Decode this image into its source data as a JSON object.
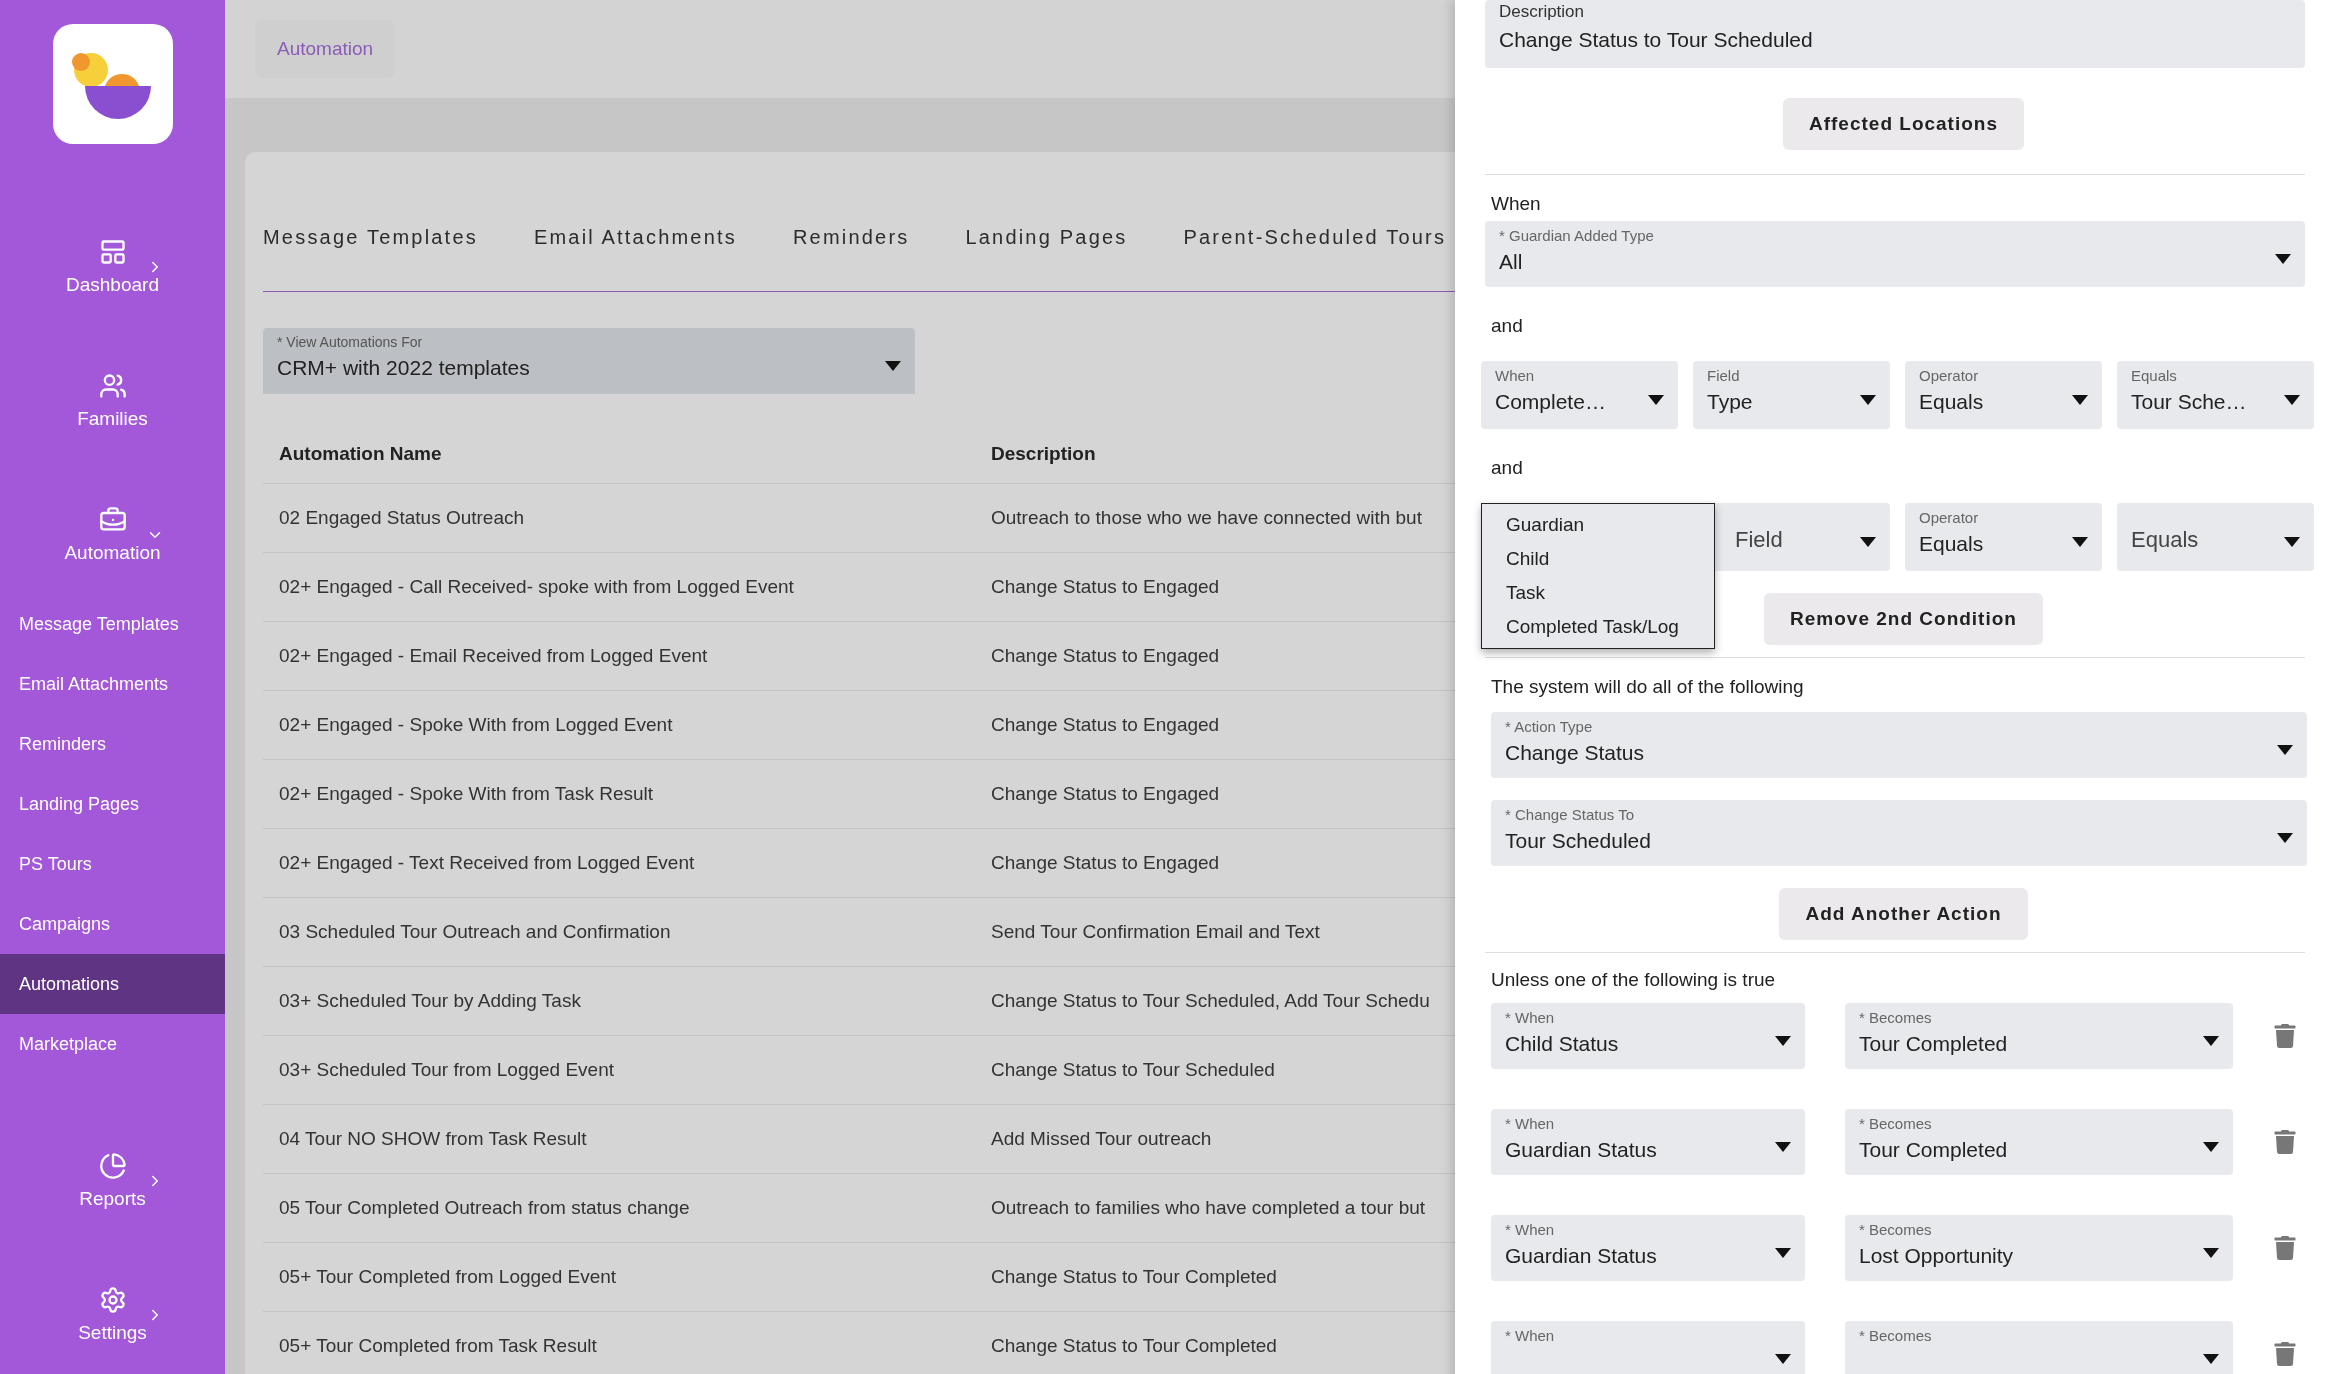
{
  "sidebar": {
    "nav": [
      {
        "label": "Dashboard",
        "kind": "dashboard",
        "expanded": false
      },
      {
        "label": "Families",
        "kind": "families"
      },
      {
        "label": "Automation",
        "kind": "automation",
        "expanded": true,
        "children": [
          {
            "label": "Message Templates",
            "selected": false
          },
          {
            "label": "Email Attachments",
            "selected": false
          },
          {
            "label": "Reminders",
            "selected": false
          },
          {
            "label": "Landing Pages",
            "selected": false
          },
          {
            "label": "PS Tours",
            "selected": false
          },
          {
            "label": "Campaigns",
            "selected": false
          },
          {
            "label": "Automations",
            "selected": true
          },
          {
            "label": "Marketplace",
            "selected": false
          }
        ]
      },
      {
        "label": "Reports",
        "kind": "reports",
        "expanded": false
      },
      {
        "label": "Settings",
        "kind": "settings",
        "expanded": false
      }
    ]
  },
  "header": {
    "breadcrumb": "Automation"
  },
  "tabs": [
    {
      "label": "Message Templates",
      "selected": false
    },
    {
      "label": "Email Attachments",
      "selected": false
    },
    {
      "label": "Reminders",
      "selected": false
    },
    {
      "label": "Landing Pages",
      "selected": false
    },
    {
      "label": "Parent-Scheduled Tours",
      "selected": false
    }
  ],
  "filter": {
    "label": "* View Automations For",
    "value": "CRM+ with 2022 templates"
  },
  "table": {
    "columns": [
      "Automation Name",
      "Description"
    ],
    "rows": [
      {
        "name": "02 Engaged Status Outreach",
        "description": "Outreach to those who we have connected with but"
      },
      {
        "name": "02+ Engaged - Call Received- spoke with from Logged Event",
        "description": "Change Status to Engaged"
      },
      {
        "name": "02+ Engaged - Email Received from Logged Event",
        "description": "Change Status to Engaged"
      },
      {
        "name": "02+ Engaged - Spoke With from Logged Event",
        "description": "Change Status to Engaged"
      },
      {
        "name": "02+ Engaged - Spoke With from Task Result",
        "description": "Change Status to Engaged"
      },
      {
        "name": "02+ Engaged - Text Received from Logged Event",
        "description": "Change Status to Engaged"
      },
      {
        "name": "03 Scheduled Tour Outreach and Confirmation",
        "description": "Send Tour Confirmation Email and Text"
      },
      {
        "name": "03+ Scheduled Tour by Adding Task",
        "description": "Change Status to Tour Scheduled, Add Tour Schedu"
      },
      {
        "name": "03+ Scheduled Tour from Logged Event",
        "description": "Change Status to Tour Scheduled"
      },
      {
        "name": "04 Tour NO SHOW from Task Result",
        "description": "Add Missed Tour outreach"
      },
      {
        "name": "05 Tour Completed Outreach from status change",
        "description": "Outreach to families who have completed a tour but"
      },
      {
        "name": "05+ Tour Completed from Logged Event",
        "description": "Change Status to Tour Completed"
      },
      {
        "name": "05+ Tour Completed from Task Result",
        "description": "Change Status to Tour Completed"
      }
    ]
  },
  "panel": {
    "description": {
      "label": "Description",
      "value": "Change Status to Tour Scheduled"
    },
    "affected_button": "Affected Locations",
    "when_heading": "When",
    "guardian_type": {
      "label": "* Guardian Added Type",
      "value": "All"
    },
    "conditions": [
      {
        "and_label": "and",
        "selects": [
          {
            "label": "When",
            "value": "Complete…"
          },
          {
            "label": "Field",
            "value": "Type"
          },
          {
            "label": "Operator",
            "value": "Equals"
          },
          {
            "label": "Equals",
            "value": "Tour Sche…"
          }
        ]
      },
      {
        "and_label": "and",
        "selects": [
          {
            "placeholder": "Field"
          },
          {
            "label": "Operator",
            "value": "Equals"
          },
          {
            "placeholder": "Equals"
          }
        ],
        "menu": [
          {
            "label": "Guardian",
            "selected": false
          },
          {
            "label": "Child",
            "selected": false
          },
          {
            "label": "Task",
            "selected": false
          },
          {
            "label": "Completed Task/Log",
            "selected": false
          }
        ]
      }
    ],
    "remove_button": "Remove 2nd Condition",
    "actions_heading": "The system will do all of the following",
    "actions": [
      {
        "label": "* Action Type",
        "value": "Change Status"
      },
      {
        "label": "* Change Status To",
        "value": "Tour Scheduled"
      }
    ],
    "add_action_button": "Add Another Action",
    "exceptions_heading": "Unless one of the following is true",
    "exceptions": [
      {
        "when": {
          "label": "* When",
          "value": "Child Status"
        },
        "becomes": {
          "label": "* Becomes",
          "value": "Tour Completed"
        }
      },
      {
        "when": {
          "label": "* When",
          "value": "Guardian Status"
        },
        "becomes": {
          "label": "* Becomes",
          "value": "Tour Completed"
        }
      },
      {
        "when": {
          "label": "* When",
          "value": "Guardian Status"
        },
        "becomes": {
          "label": "* Becomes",
          "value": "Lost Opportunity"
        }
      },
      {
        "when": {
          "label": "* When"
        },
        "becomes": {
          "label": "* Becomes"
        }
      }
    ]
  }
}
